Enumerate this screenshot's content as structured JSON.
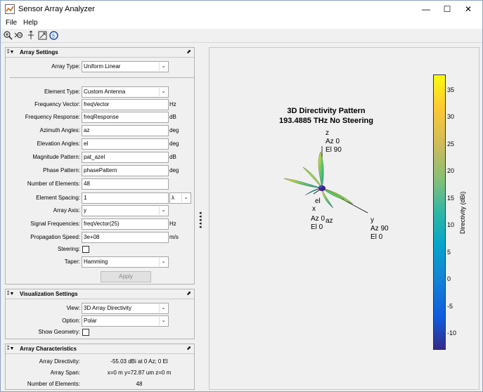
{
  "window": {
    "title": "Sensor Array Analyzer",
    "minimize": "—",
    "maximize": "☐",
    "close": "✕"
  },
  "menu": {
    "file": "File",
    "help": "Help"
  },
  "array_settings": {
    "header": "Array Settings",
    "array_type_label": "Array Type:",
    "array_type": "Uniform Linear",
    "element_type_label": "Element Type:",
    "element_type": "Custom Antenna",
    "frequency_vector_label": "Frequency Vector:",
    "frequency_vector": "freqVector",
    "frequency_vector_unit": "Hz",
    "frequency_response_label": "Frequency Response:",
    "frequency_response": "freqResponse",
    "frequency_response_unit": "dB",
    "azimuth_angles_label": "Azimuth Angles:",
    "azimuth_angles": "az",
    "azimuth_angles_unit": "deg",
    "elevation_angles_label": "Elevation Angles:",
    "elevation_angles": "el",
    "elevation_angles_unit": "deg",
    "magnitude_pattern_label": "Magnitude Pattern:",
    "magnitude_pattern": "pat_azel",
    "magnitude_pattern_unit": "dB",
    "phase_pattern_label": "Phase Pattern:",
    "phase_pattern": "phasePattern",
    "phase_pattern_unit": "deg",
    "num_elements_label": "Number of Elements:",
    "num_elements": "48",
    "element_spacing_label": "Element Spacing:",
    "element_spacing": "1",
    "element_spacing_unit": "λ",
    "array_axis_label": "Array Axis:",
    "array_axis": "y",
    "signal_frequencies_label": "Signal Frequencies:",
    "signal_frequencies": "freqVector(25)",
    "signal_frequencies_unit": "Hz",
    "propagation_speed_label": "Propagation Speed:",
    "propagation_speed": "3e+08",
    "propagation_speed_unit": "m/s",
    "steering_label": "Steering:",
    "taper_label": "Taper:",
    "taper": "Hamming",
    "apply": "Apply"
  },
  "visualization_settings": {
    "header": "Visualization Settings",
    "view_label": "View:",
    "view": "3D Array Directivity",
    "option_label": "Option:",
    "option": "Polar",
    "show_geometry_label": "Show Geometry:"
  },
  "array_characteristics": {
    "header": "Array Characteristics",
    "directivity_label": "Array Directivity:",
    "directivity": "-55.03 dBi at 0 Az; 0 El",
    "span_label": "Array Span:",
    "span": "x=0 m y=72.87 um z=0 m",
    "num_elements_label": "Number of Elements:",
    "num_elements": "48"
  },
  "plot": {
    "title_line1": "3D Directivity Pattern",
    "title_line2": "193.4885 THz No Steering",
    "z_label": "z",
    "z_az": "Az 0",
    "z_el": "El 90",
    "y_label": "y",
    "y_az": "Az 90",
    "y_el": "El 0",
    "x_label": "x",
    "x_az": "Az 0",
    "x_el": "El 0",
    "el_marker": "el",
    "az_marker": "az"
  },
  "chart_data": {
    "type": "heatmap",
    "title": "3D Directivity Pattern",
    "subtitle": "193.4885 THz No Steering",
    "colorbar_label": "Directivity (dBi)",
    "colorbar_ticks": [
      "35",
      "30",
      "25",
      "20",
      "15",
      "10",
      "5",
      "0",
      "-5",
      "-10"
    ],
    "colorbar_range": [
      -13,
      38
    ],
    "colormap": "parula"
  },
  "colors": {
    "lobe_yellow": "#f9e21e",
    "lobe_green": "#5ec962",
    "lobe_teal": "#21a0a5",
    "lobe_blue": "#2e4fb8",
    "lobe_dark": "#3e1f8a"
  }
}
